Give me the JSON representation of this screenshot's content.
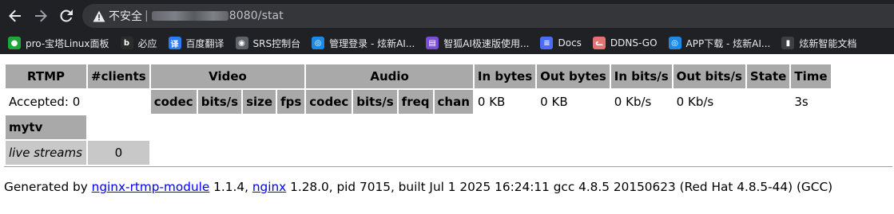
{
  "browser": {
    "security_label": "不安全",
    "separator": "|",
    "url_tail": "8080/stat",
    "bookmarks": [
      {
        "label": "pro-宝塔Linux面板",
        "icon": "baota-icon",
        "color": "#20a53a"
      },
      {
        "label": "必应",
        "icon": "bing-icon",
        "color": "#2b2b2b"
      },
      {
        "label": "百度翻译",
        "icon": "translate-icon",
        "color": "#2d7cf6"
      },
      {
        "label": "SRS控制台",
        "icon": "globe-icon",
        "color": "#5f6368"
      },
      {
        "label": "管理登录 - 炫新AI...",
        "icon": "app-icon",
        "color": "#1e88e5"
      },
      {
        "label": "智狐AI极速版使用...",
        "icon": "document-icon",
        "color": "#7b4dd6"
      },
      {
        "label": "Docs",
        "icon": "docs-icon",
        "color": "#4a6cf7"
      },
      {
        "label": "DDNS-GO",
        "icon": "cat-icon",
        "color": "#e57373"
      },
      {
        "label": "APP下载 - 炫新AI...",
        "icon": "app-icon",
        "color": "#1e88e5"
      },
      {
        "label": "炫新智能文档",
        "icon": "book-icon",
        "color": "#3c4043"
      }
    ]
  },
  "stat": {
    "headers": {
      "rtmp": "RTMP",
      "clients": "#clients",
      "video": "Video",
      "audio": "Audio",
      "in_bytes": "In bytes",
      "out_bytes": "Out bytes",
      "in_bits": "In bits/s",
      "out_bits": "Out bits/s",
      "state": "State",
      "time": "Time"
    },
    "video_sub": [
      "codec",
      "bits/s",
      "size",
      "fps"
    ],
    "audio_sub": [
      "codec",
      "bits/s",
      "freq",
      "chan"
    ],
    "accepted": "Accepted: 0",
    "in_bytes": "0 KB",
    "out_bytes": "0 KB",
    "in_bits": "0 Kb/s",
    "out_bits": "0 Kb/s",
    "time": "3s",
    "app_name": "mytv",
    "live_streams_label": "live streams",
    "live_streams_count": "0"
  },
  "footer": {
    "prefix": "Generated by ",
    "module_link": "nginx-rtmp-module",
    "module_version": " 1.1.4, ",
    "nginx_link": "nginx",
    "rest": " 1.28.0, pid 7015, built Jul 1 2025 16:24:11 gcc 4.8.5 20150623 (Red Hat 4.8.5-44) (GCC)"
  }
}
